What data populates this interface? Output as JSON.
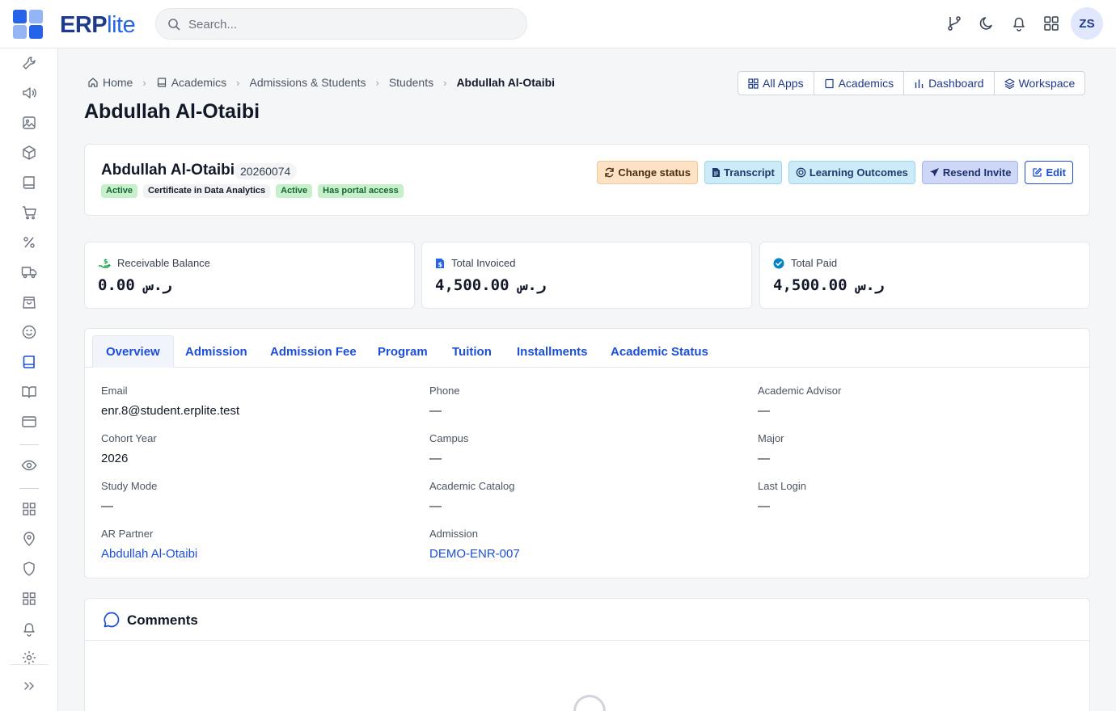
{
  "app": {
    "name_main": "ERP",
    "name_accent": "lite"
  },
  "search": {
    "placeholder": "Search..."
  },
  "user": {
    "initials": "ZS"
  },
  "breadcrumb": [
    {
      "label": "Home",
      "icon": "home-icon"
    },
    {
      "label": "Academics",
      "icon": "book-icon"
    },
    {
      "label": "Admissions & Students"
    },
    {
      "label": "Students"
    },
    {
      "label": "Abdullah Al-Otaibi"
    }
  ],
  "app_links": [
    {
      "label": "All Apps",
      "icon": "grid-icon"
    },
    {
      "label": "Academics",
      "icon": "book-icon"
    },
    {
      "label": "Dashboard",
      "icon": "bar-chart-icon"
    },
    {
      "label": "Workspace",
      "icon": "layers-icon"
    }
  ],
  "page_title": "Abdullah Al-Otaibi",
  "student": {
    "name": "Abdullah Al-Otaibi",
    "id": "20260074",
    "badges": [
      "Active",
      "Certificate in Data Analytics",
      "Active",
      "Has portal access"
    ]
  },
  "actions": {
    "change_status": "Change status",
    "transcript": "Transcript",
    "learning_outcomes": "Learning Outcomes",
    "resend_invite": "Resend Invite",
    "edit": "Edit"
  },
  "stats": [
    {
      "label": "Receivable Balance",
      "value": "0.00 ر.س",
      "icon": "money-hand-icon",
      "color": "#16a34a"
    },
    {
      "label": "Total Invoiced",
      "value": "4,500.00 ر.س",
      "icon": "invoice-icon",
      "color": "#2563eb"
    },
    {
      "label": "Total Paid",
      "value": "4,500.00 ر.س",
      "icon": "check-circle-icon",
      "color": "#0284c7"
    }
  ],
  "tabs": [
    "Overview",
    "Admission",
    "Admission Fee",
    "Program",
    "Tuition",
    "Installments",
    "Academic Status"
  ],
  "fields": {
    "email": {
      "label": "Email",
      "value": "enr.8@student.erplite.test"
    },
    "phone": {
      "label": "Phone",
      "value": "—"
    },
    "advisor": {
      "label": "Academic Advisor",
      "value": "—"
    },
    "cohort": {
      "label": "Cohort Year",
      "value": "2026"
    },
    "campus": {
      "label": "Campus",
      "value": "—"
    },
    "major": {
      "label": "Major",
      "value": "—"
    },
    "study_mode": {
      "label": "Study Mode",
      "value": "—"
    },
    "catalog": {
      "label": "Academic Catalog",
      "value": "—"
    },
    "last_login": {
      "label": "Last Login",
      "value": "—"
    },
    "ar_partner": {
      "label": "AR Partner",
      "value": "Abdullah Al-Otaibi"
    },
    "admission": {
      "label": "Admission",
      "value": "DEMO-ENR-007"
    }
  },
  "comments": {
    "title": "Comments"
  },
  "colors": {
    "accent": "#1d4ed8",
    "brand": "#1e3a8a",
    "success_badge": "#c7efc9"
  }
}
